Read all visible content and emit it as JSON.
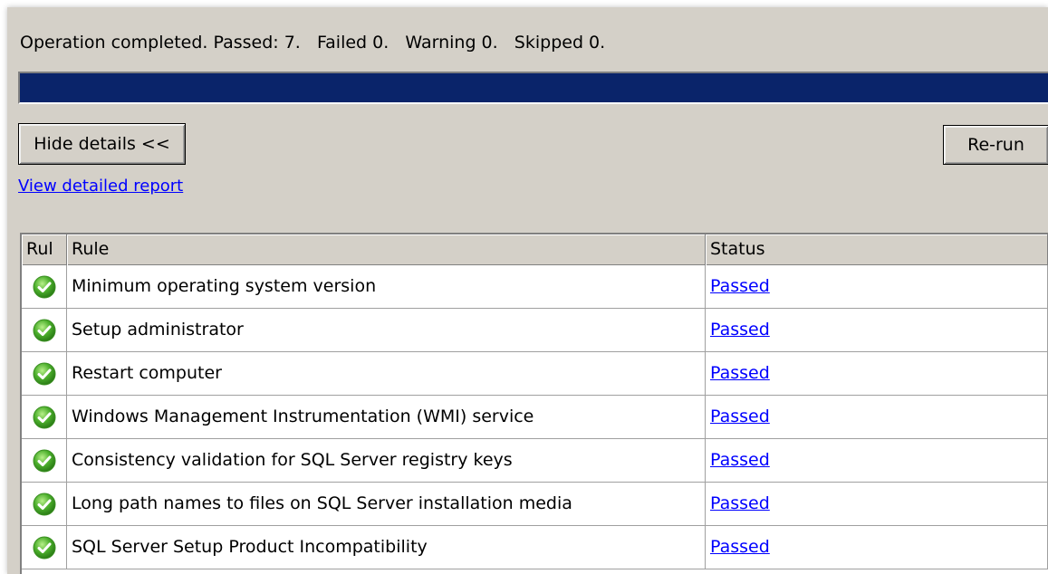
{
  "status": {
    "summary": "Operation completed. Passed: 7.   Failed 0.   Warning 0.   Skipped 0.",
    "progress_percent": 100,
    "progress_color": "#0a246a"
  },
  "buttons": {
    "hide_details": "Hide details <<",
    "rerun": "Re-run"
  },
  "report_link": "View detailed report",
  "table": {
    "headers": {
      "icon": "Rul",
      "rule": "Rule",
      "status": "Status"
    },
    "rows": [
      {
        "icon": "check-circle-icon",
        "rule": "Minimum operating system version",
        "status": "Passed"
      },
      {
        "icon": "check-circle-icon",
        "rule": "Setup administrator",
        "status": "Passed"
      },
      {
        "icon": "check-circle-icon",
        "rule": "Restart computer",
        "status": "Passed"
      },
      {
        "icon": "check-circle-icon",
        "rule": "Windows Management Instrumentation (WMI) service",
        "status": "Passed"
      },
      {
        "icon": "check-circle-icon",
        "rule": "Consistency validation for SQL Server registry keys",
        "status": "Passed"
      },
      {
        "icon": "check-circle-icon",
        "rule": "Long path names to files on SQL Server installation media",
        "status": "Passed"
      },
      {
        "icon": "check-circle-icon",
        "rule": "SQL Server Setup Product Incompatibility",
        "status": "Passed"
      }
    ]
  },
  "colors": {
    "window_bg": "#d4d0c8",
    "link": "#0000ff",
    "passed_green": "#4caf2c"
  }
}
